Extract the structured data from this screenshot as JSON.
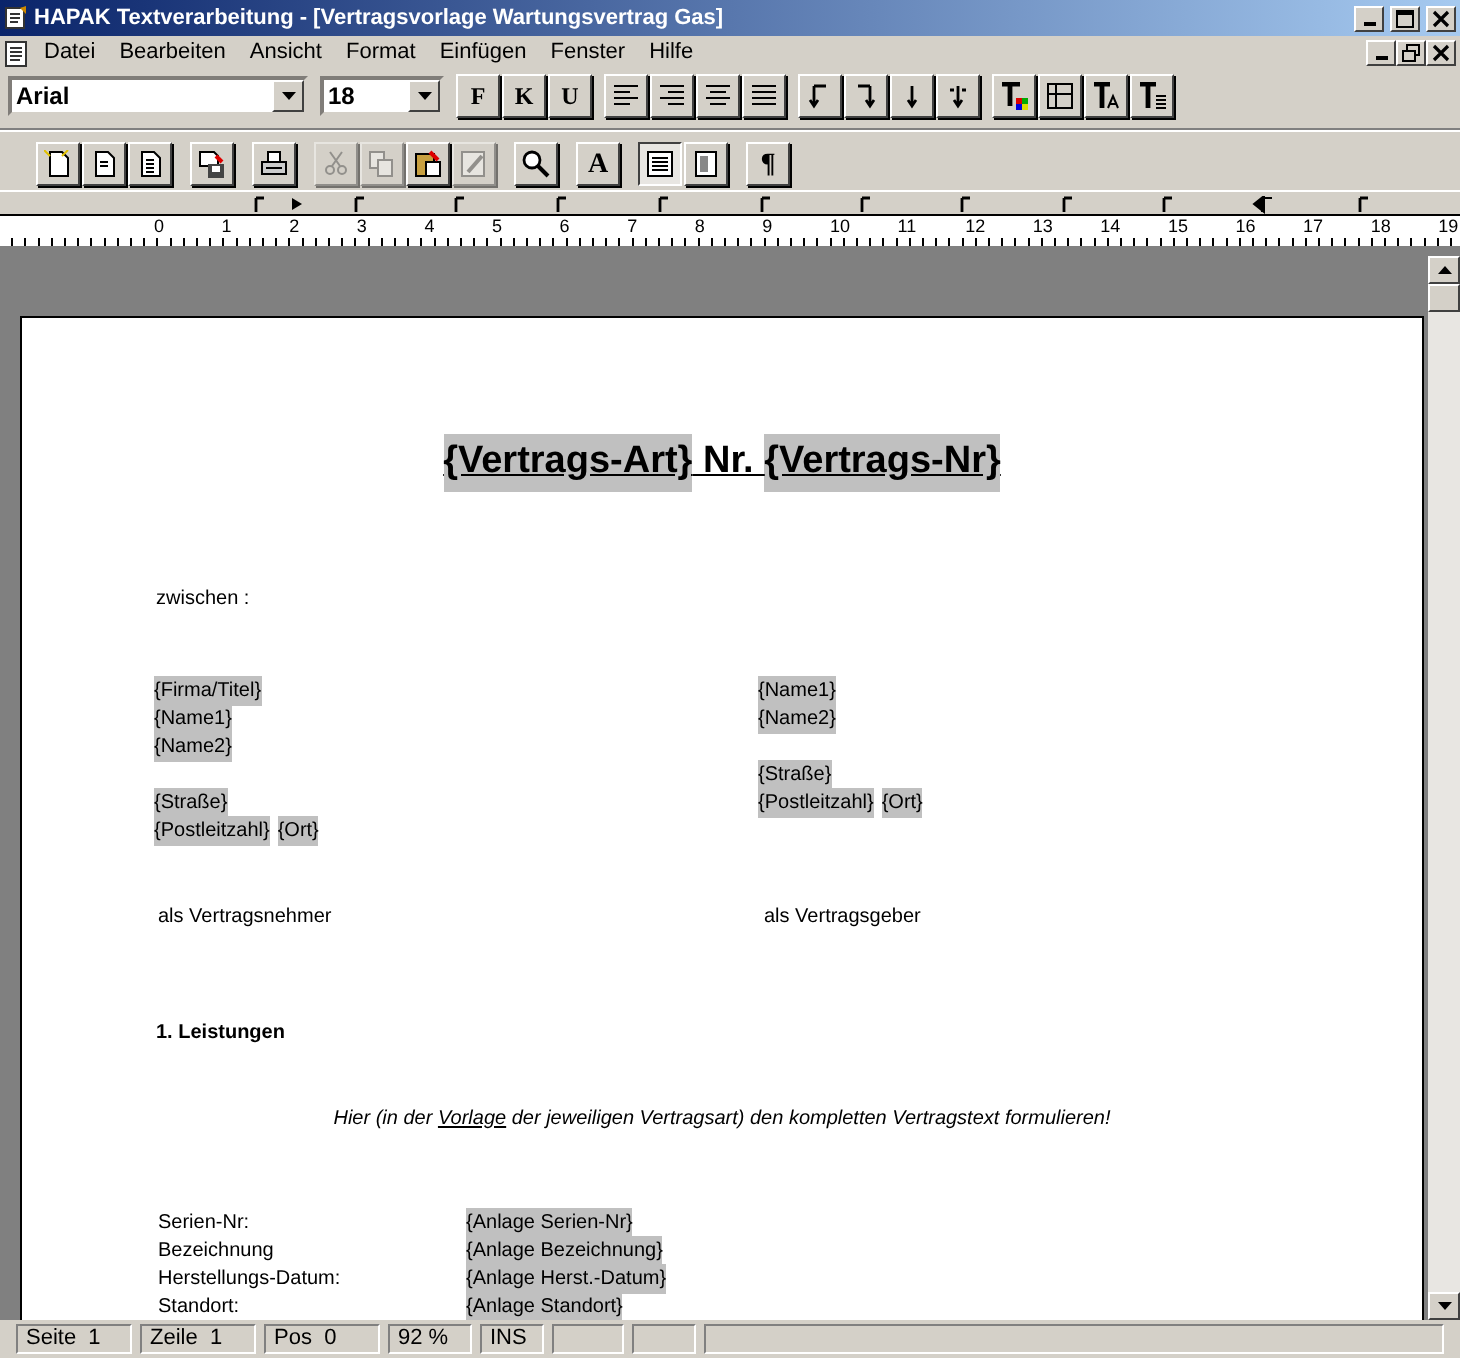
{
  "window": {
    "title": "HAPAK Textverarbeitung - [Vertragsvorlage Wartungsvertrag Gas]"
  },
  "menu": [
    "Datei",
    "Bearbeiten",
    "Ansicht",
    "Format",
    "Einfügen",
    "Fenster",
    "Hilfe"
  ],
  "format_toolbar": {
    "font": "Arial",
    "size": "18",
    "groups": [
      [
        {
          "kind": "text",
          "label": "F"
        },
        {
          "kind": "text",
          "label": "K"
        },
        {
          "kind": "text",
          "label": "U"
        }
      ],
      [
        {
          "kind": "icon"
        },
        {
          "kind": "icon"
        },
        {
          "kind": "icon"
        },
        {
          "kind": "icon"
        }
      ],
      [
        {
          "kind": "icon"
        },
        {
          "kind": "icon"
        },
        {
          "kind": "icon"
        },
        {
          "kind": "icon"
        }
      ],
      [
        {
          "kind": "icon"
        },
        {
          "kind": "icon"
        },
        {
          "kind": "icon"
        },
        {
          "kind": "icon"
        }
      ]
    ]
  },
  "toolbar": {
    "groups": [
      [
        {
          "kind": "icon",
          "disabled": false,
          "pressed": false
        },
        {
          "kind": "icon",
          "disabled": false,
          "pressed": false
        },
        {
          "kind": "icon",
          "disabled": false,
          "pressed": false
        }
      ],
      [
        {
          "kind": "icon",
          "disabled": false,
          "pressed": false
        }
      ],
      [
        {
          "kind": "icon",
          "disabled": false,
          "pressed": false
        }
      ],
      [
        {
          "kind": "icon",
          "disabled": true,
          "pressed": false
        },
        {
          "kind": "icon",
          "disabled": true,
          "pressed": false
        },
        {
          "kind": "icon",
          "disabled": false,
          "pressed": false
        },
        {
          "kind": "icon",
          "disabled": true,
          "pressed": false
        }
      ],
      [
        {
          "kind": "icon",
          "disabled": false,
          "pressed": false
        }
      ],
      [
        {
          "kind": "text",
          "label": "A",
          "disabled": false,
          "pressed": false
        }
      ],
      [
        {
          "kind": "icon",
          "disabled": false,
          "pressed": true
        },
        {
          "kind": "icon",
          "disabled": false,
          "pressed": false
        }
      ],
      [
        {
          "kind": "text",
          "label": "¶",
          "disabled": false,
          "pressed": false
        }
      ]
    ]
  },
  "ruler": {
    "labels": [
      "0",
      "1",
      "2",
      "3",
      "4",
      "5",
      "6",
      "7",
      "8",
      "9",
      "10",
      "11",
      "12",
      "13",
      "14",
      "15",
      "16",
      "17",
      "18",
      "19"
    ]
  },
  "document": {
    "heading": [
      {
        "text": "{Vertrags-Art}",
        "field": true
      },
      {
        "text": " Nr. ",
        "field": false
      },
      {
        "text": "{Vertrags-Nr}",
        "field": true
      }
    ],
    "intro": "zwischen :",
    "parties": [
      {
        "paragraphs": [
          [
            [
              "{Firma/Titel}"
            ],
            [
              "{Name1}"
            ],
            [
              "{Name2}"
            ]
          ],
          [
            [
              "{Straße}"
            ],
            [
              "{Postleitzahl}",
              "{Ort}"
            ]
          ]
        ],
        "role": "als Vertragsnehmer"
      },
      {
        "paragraphs": [
          [
            [
              "{Name1}"
            ],
            [
              "{Name2}"
            ]
          ],
          [
            [
              "{Straße}"
            ],
            [
              "{Postleitzahl}",
              "{Ort}"
            ]
          ]
        ],
        "role": "als Vertragsgeber"
      }
    ],
    "section_title": "1. Leistungen",
    "instruction": [
      {
        "text": "Hier (in der ",
        "underline": false
      },
      {
        "text": "Vorlage",
        "underline": true
      },
      {
        "text": " der jeweiligen Vertragsart) den kompletten Vertragstext formulieren!",
        "underline": false
      }
    ],
    "details": [
      {
        "label": "Serien-Nr:",
        "value": "{Anlage Serien-Nr}"
      },
      {
        "label": "Bezeichnung",
        "value": "{Anlage Bezeichnung}"
      },
      {
        "label": "Herstellungs-Datum:",
        "value": "{Anlage Herst.-Datum}"
      },
      {
        "label": "Standort:",
        "value": "{Anlage Standort}"
      }
    ]
  },
  "status_bar": [
    "Seite  1",
    "Zeile  1",
    "Pos  0",
    "92 %",
    "INS"
  ]
}
